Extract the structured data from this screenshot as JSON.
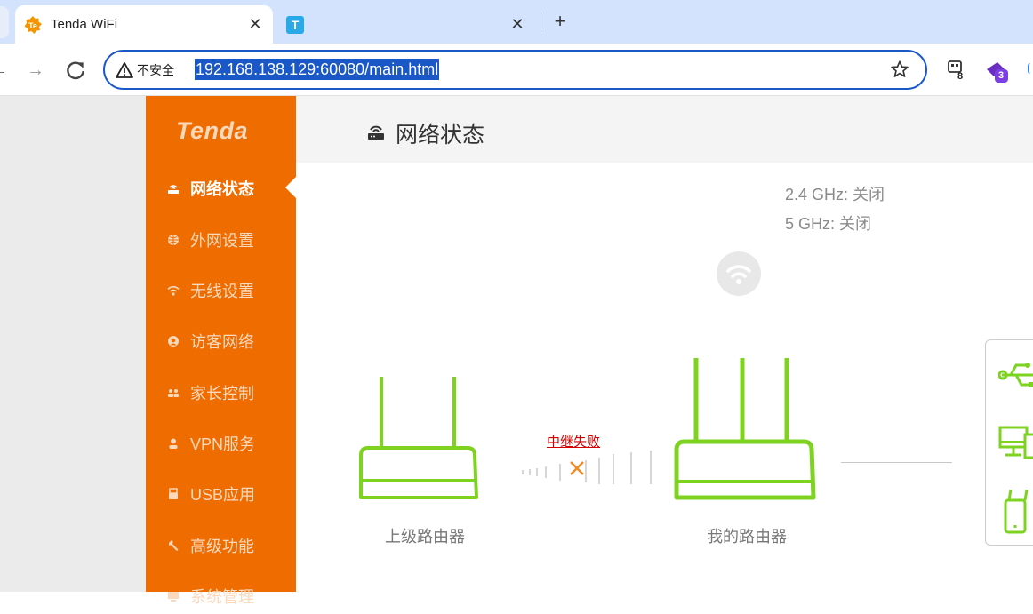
{
  "browser": {
    "tabs": [
      {
        "title": "Tenda WiFi",
        "active": true,
        "favicon": "tenda-favicon"
      },
      {
        "title": "",
        "active": false,
        "favicon": "t-app-favicon"
      }
    ],
    "omnibox": {
      "security_label": "不安全",
      "url": "192.168.138.129:60080/main.html"
    },
    "extensions": [
      {
        "name": "extension-counter-icon",
        "badge": "8"
      },
      {
        "name": "extension-purple-icon",
        "badge": "3"
      }
    ]
  },
  "app": {
    "logo": "Tenda",
    "nav": [
      {
        "label": "网络状态",
        "icon": "router-icon",
        "active": true
      },
      {
        "label": "外网设置",
        "icon": "globe-icon",
        "active": false
      },
      {
        "label": "无线设置",
        "icon": "wifi-icon",
        "active": false
      },
      {
        "label": "访客网络",
        "icon": "guest-icon",
        "active": false
      },
      {
        "label": "家长控制",
        "icon": "family-icon",
        "active": false
      },
      {
        "label": "VPN服务",
        "icon": "vpn-icon",
        "active": false
      },
      {
        "label": "USB应用",
        "icon": "usb-icon",
        "active": false
      },
      {
        "label": "高级功能",
        "icon": "wrench-icon",
        "active": false
      },
      {
        "label": "系统管理",
        "icon": "system-icon",
        "active": false
      }
    ],
    "header": {
      "title": "网络状态"
    },
    "wifi_status": {
      "band_24": "2.4 GHz: 关闭",
      "band_5": "5 GHz: 关闭"
    },
    "topology": {
      "upstream_label": "上级路由器",
      "relay_status": "中继失败",
      "my_router_label": "我的路由器"
    },
    "colors": {
      "accent": "#ee6c00",
      "router_green": "#7ed321",
      "error_red": "#d40000",
      "fail_orange": "#f08a24"
    }
  }
}
